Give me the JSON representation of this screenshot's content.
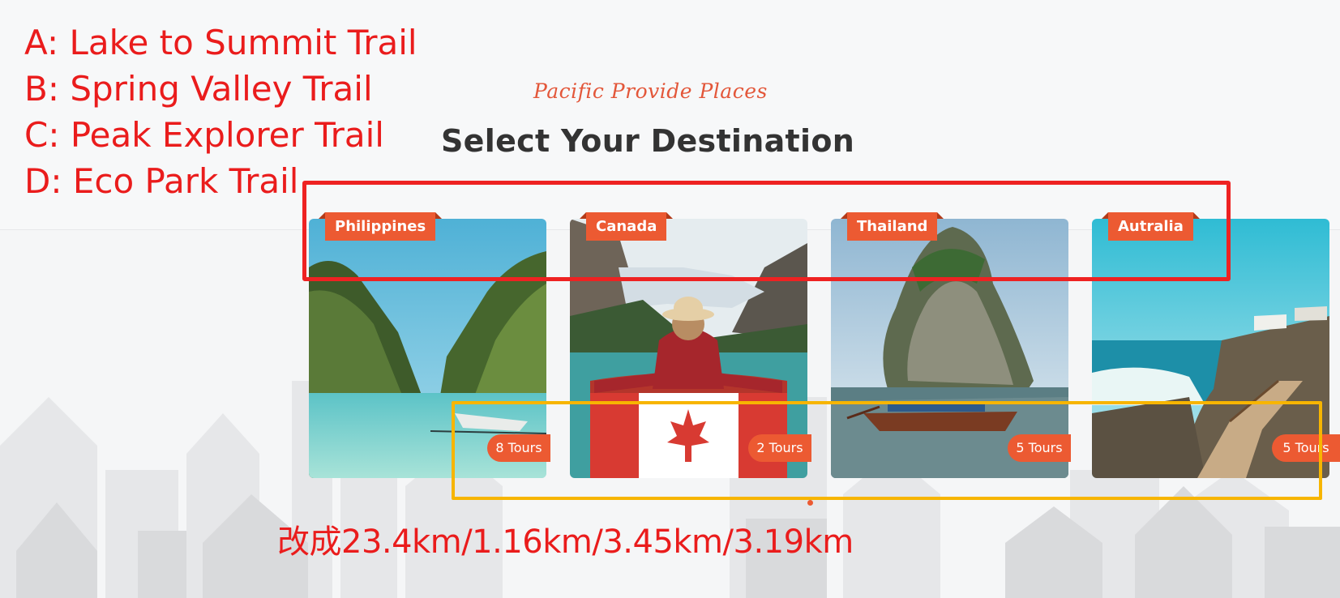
{
  "annotations": {
    "options": [
      "A: Lake to Summit Trail",
      "B: Spring Valley Trail",
      "C: Peak Explorer Trail",
      "D: Eco Park Trail"
    ],
    "instruction": "改成23.4km/1.16km/3.45km/3.19km",
    "highlight_colors": {
      "names": "#ee2222",
      "tours": "#f7b500"
    }
  },
  "section": {
    "subtitle": "Pacific Provide Places",
    "title": "Select Your Destination"
  },
  "destinations": [
    {
      "name": "Philippines",
      "tours": "8 Tours",
      "photo_icon": "lagoon-boat-photo"
    },
    {
      "name": "Canada",
      "tours": "2 Tours",
      "photo_icon": "lake-flag-photo"
    },
    {
      "name": "Thailand",
      "tours": "5 Tours",
      "photo_icon": "rock-island-boat-photo"
    },
    {
      "name": "Autralia",
      "tours": "5 Tours",
      "photo_icon": "coast-boardwalk-photo"
    }
  ],
  "colors": {
    "accent": "#ec5a32",
    "title": "#333333",
    "annotation_red": "#ea1c1c"
  }
}
